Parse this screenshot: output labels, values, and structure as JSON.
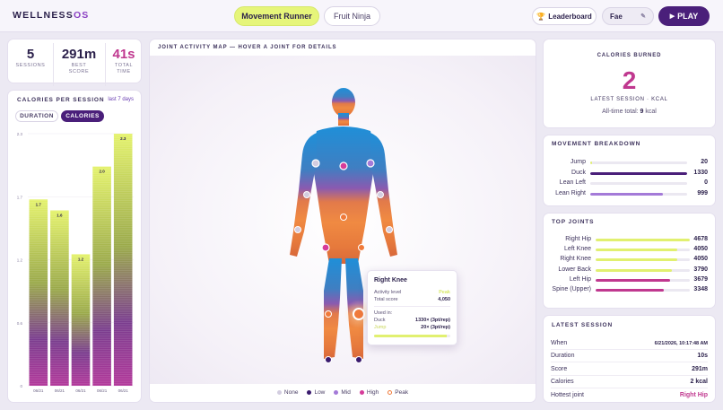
{
  "header": {
    "logo_main": "WELLNESS",
    "logo_accent": "OS",
    "tabs": [
      {
        "label": "Movement Runner",
        "active": true
      },
      {
        "label": "Fruit Ninja",
        "active": false
      }
    ],
    "leaderboard_label": "Leaderboard",
    "player_name": "Fae",
    "play_label": "PLAY"
  },
  "stats": {
    "sessions": {
      "value": "5",
      "label": "SESSIONS"
    },
    "best_score": {
      "value": "291m",
      "label": "BEST SCORE"
    },
    "total_time": {
      "value": "41s",
      "label": "TOTAL TIME"
    }
  },
  "calories_chart": {
    "title": "CALORIES PER SESSION",
    "range_link": "last 7 days",
    "toggle": [
      {
        "label": "DURATION",
        "active": false
      },
      {
        "label": "CALORIES",
        "active": true
      }
    ]
  },
  "chart_data": {
    "type": "bar",
    "categories": [
      "06/21",
      "06/21",
      "06/21",
      "06/21",
      "06/21"
    ],
    "values": [
      1.7,
      1.6,
      1.2,
      2.0,
      2.3
    ],
    "value_labels": [
      "1.7",
      "1.6",
      "1.2",
      "2.0",
      "2.3"
    ],
    "yticks": [
      "2.3",
      "1.7",
      "1.2",
      "0.6",
      "0"
    ],
    "ylim": [
      0,
      2.3
    ],
    "title": "CALORIES PER SESSION",
    "grid": true
  },
  "map": {
    "title": "JOINT ACTIVITY MAP — HOVER A JOINT FOR DETAILS",
    "legend": [
      {
        "label": "None",
        "color": "#d3cde0"
      },
      {
        "label": "Low",
        "color": "#3a1a6e"
      },
      {
        "label": "Mid",
        "color": "#a47ad8"
      },
      {
        "label": "High",
        "color": "#d63c9a"
      },
      {
        "label": "Peak",
        "color": "#f07a3a"
      }
    ],
    "tooltip": {
      "title": "Right Knee",
      "activity_label": "Activity level",
      "activity_value": "Peak",
      "score_label": "Total score",
      "score_value": "4,050",
      "used_in_label": "Used in:",
      "moves": [
        {
          "name": "Duck",
          "value": "1330× (3pt/rep)",
          "highlight": false
        },
        {
          "name": "Jump",
          "value": "20× (3pt/rep)",
          "highlight": true
        }
      ],
      "bar_fraction": 0.95
    }
  },
  "calories_burned": {
    "title": "CALORIES BURNED",
    "value": "2",
    "caption": "LATEST SESSION · KCAL",
    "all_time_prefix": "All-time total:",
    "all_time_value": "9",
    "all_time_unit": "kcal"
  },
  "movement_breakdown": {
    "title": "MOVEMENT BREAKDOWN",
    "items": [
      {
        "label": "Jump",
        "value": "20",
        "fraction": 0.02,
        "color": "#e1f070"
      },
      {
        "label": "Duck",
        "value": "1330",
        "fraction": 1.0,
        "color": "#4a1f7a"
      },
      {
        "label": "Lean Left",
        "value": "0",
        "fraction": 0.0,
        "color": "#a47ad8"
      },
      {
        "label": "Lean Right",
        "value": "999",
        "fraction": 0.75,
        "color": "#a47ad8"
      }
    ]
  },
  "top_joints": {
    "title": "TOP JOINTS",
    "items": [
      {
        "label": "Right Hip",
        "value": "4678",
        "fraction": 1.0,
        "color": "#e1f070"
      },
      {
        "label": "Left Knee",
        "value": "4050",
        "fraction": 0.87,
        "color": "#e1f070"
      },
      {
        "label": "Right Knee",
        "value": "4050",
        "fraction": 0.87,
        "color": "#e1f070"
      },
      {
        "label": "Lower Back",
        "value": "3790",
        "fraction": 0.81,
        "color": "#e1f070"
      },
      {
        "label": "Left Hip",
        "value": "3679",
        "fraction": 0.79,
        "color": "#c0388f"
      },
      {
        "label": "Spine (Upper)",
        "value": "3348",
        "fraction": 0.72,
        "color": "#c0388f"
      }
    ]
  },
  "latest_session": {
    "title": "LATEST SESSION",
    "rows": [
      {
        "label": "When",
        "value": "6/21/2026, 10:17:48 AM",
        "pink": false
      },
      {
        "label": "Duration",
        "value": "10s",
        "pink": false
      },
      {
        "label": "Score",
        "value": "291m",
        "pink": false
      },
      {
        "label": "Calories",
        "value": "2 kcal",
        "pink": false
      },
      {
        "label": "Hottest joint",
        "value": "Right Hip",
        "pink": true
      }
    ]
  },
  "colors": {
    "accent": "#4a1f7a",
    "lime": "#e1f070",
    "pink": "#c0388f"
  }
}
